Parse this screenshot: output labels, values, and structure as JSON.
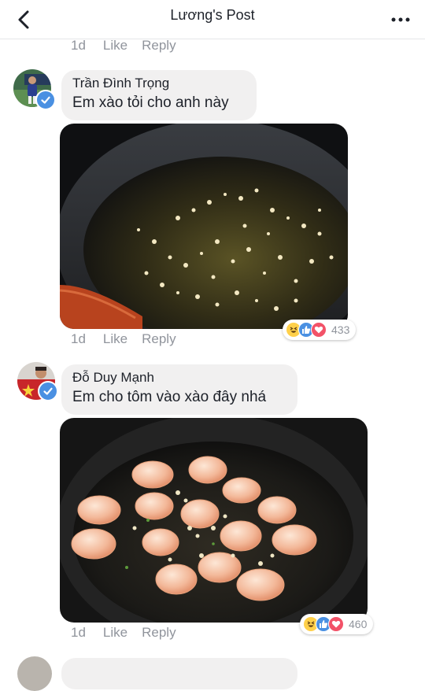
{
  "header": {
    "title": "Lương's Post"
  },
  "top_actions": {
    "time": "1d",
    "like": "Like",
    "reply": "Reply"
  },
  "comments": [
    {
      "author": "Trần Đình Trọng",
      "text": "Em xào tỏi cho anh này",
      "time": "1d",
      "like": "Like",
      "reply": "Reply",
      "reaction_count": "433",
      "reactions": [
        "haha",
        "like",
        "love"
      ]
    },
    {
      "author": "Đỗ Duy Mạnh",
      "text": "Em cho tôm vào xào đây nhá",
      "time": "1d",
      "like": "Like",
      "reply": "Reply",
      "reaction_count": "460",
      "reactions": [
        "haha",
        "like",
        "love"
      ]
    }
  ],
  "colors": {
    "bubble": "#f1f0f0",
    "meta": "#90949c",
    "like_blue": "#4a90e2",
    "love_red": "#f25268",
    "haha_yellow": "#ffd04a"
  }
}
